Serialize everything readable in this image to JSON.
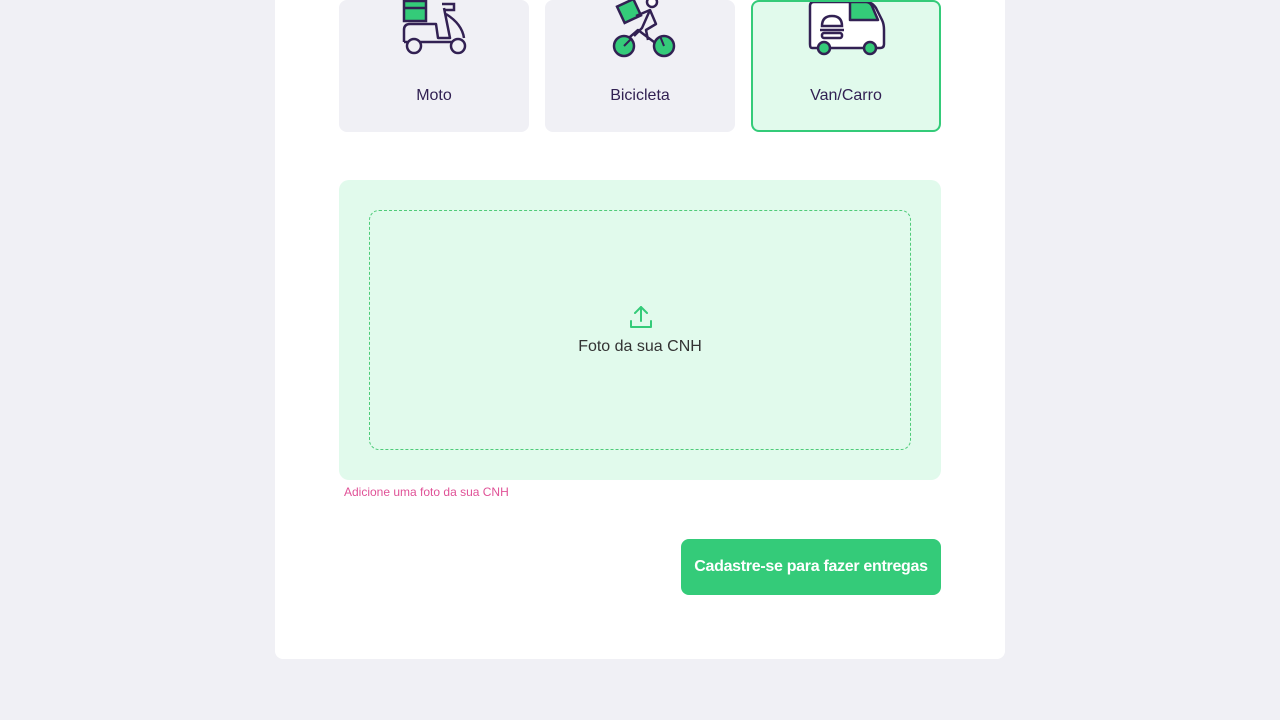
{
  "vehicles": [
    {
      "label": "Moto",
      "icon": "scooter-icon",
      "selected": false
    },
    {
      "label": "Bicicleta",
      "icon": "bicycle-icon",
      "selected": false
    },
    {
      "label": "Van/Carro",
      "icon": "van-icon",
      "selected": true
    }
  ],
  "upload": {
    "label": "Foto da sua CNH",
    "icon": "upload-icon",
    "error": "Adicione uma foto da sua CNH"
  },
  "form": {
    "submit_label": "Cadastre-se para fazer entregas"
  },
  "colors": {
    "background": "#F0F0F5",
    "card": "#FFFFFF",
    "accent": "#34CB79",
    "accent_light": "#E1FAEC",
    "text": "#322153",
    "error": "#E05297"
  }
}
